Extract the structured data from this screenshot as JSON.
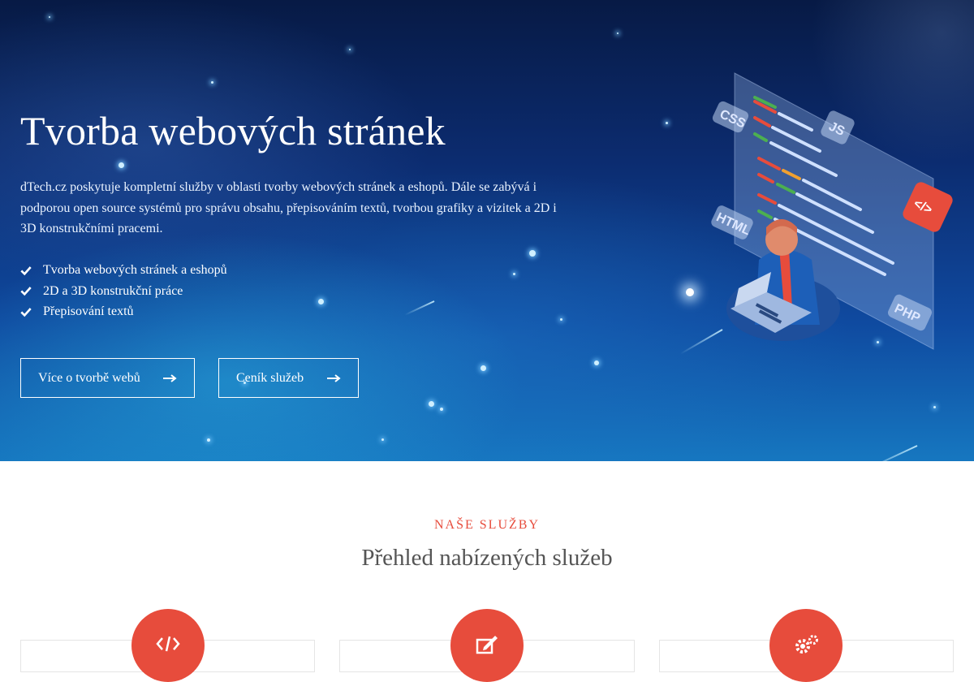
{
  "hero": {
    "title": "Tvorba webových stránek",
    "description": "dTech.cz poskytuje kompletní služby v oblasti tvorby webových stránek a eshopů. Dále se zabývá i podporou open source systémů pro správu obsahu, přepisováním textů, tvorbou grafiky a vizitek a 2D i 3D konstrukčními pracemi.",
    "features": [
      "Tvorba webových stránek a eshopů",
      "2D a 3D konstrukční práce",
      "Přepisování textů"
    ],
    "buttons": {
      "about_label": "Více o tvorbě webů",
      "pricing_label": "Ceník služeb"
    },
    "illustration": {
      "badges": [
        "CSS",
        "JS",
        "HTML",
        "PHP",
        "</>"
      ]
    }
  },
  "services": {
    "eyebrow": "NAŠE SLUŽBY",
    "title": "Přehled nabízených služeb",
    "icons": [
      "code-icon",
      "edit-icon",
      "gears-icon"
    ]
  },
  "colors": {
    "accent": "#e74c3c",
    "hero_dark": "#071a45",
    "hero_light": "#1677c0"
  }
}
